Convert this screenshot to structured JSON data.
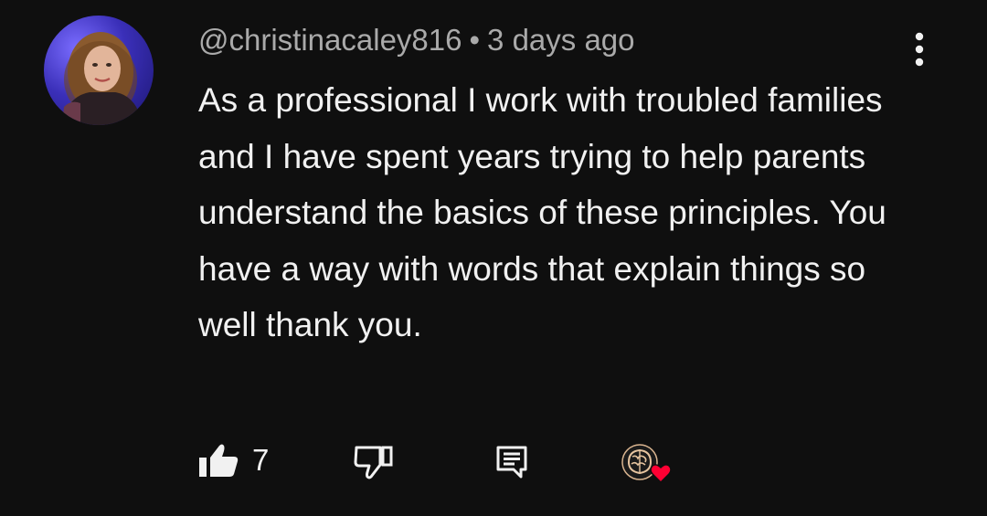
{
  "comment": {
    "author": "@christinacaley816",
    "separator": "•",
    "timestamp": "3 days ago",
    "text": "As a professional I work with troubled families and I have spent years trying to help parents understand the basics of these principles. You have a way with words that explain things so well thank you.",
    "like_count": "7",
    "icons": {
      "avatar": "user-avatar",
      "menu": "more-vert-icon",
      "like": "thumbs-up-filled-icon",
      "dislike": "thumbs-down-icon",
      "reply": "reply-comment-icon",
      "creator_heart": "creator-heart-icon"
    }
  },
  "colors": {
    "background": "#0f0f0f",
    "text_primary": "#f1f1f1",
    "text_secondary": "#aaaaaa",
    "heart": "#ff0033"
  }
}
